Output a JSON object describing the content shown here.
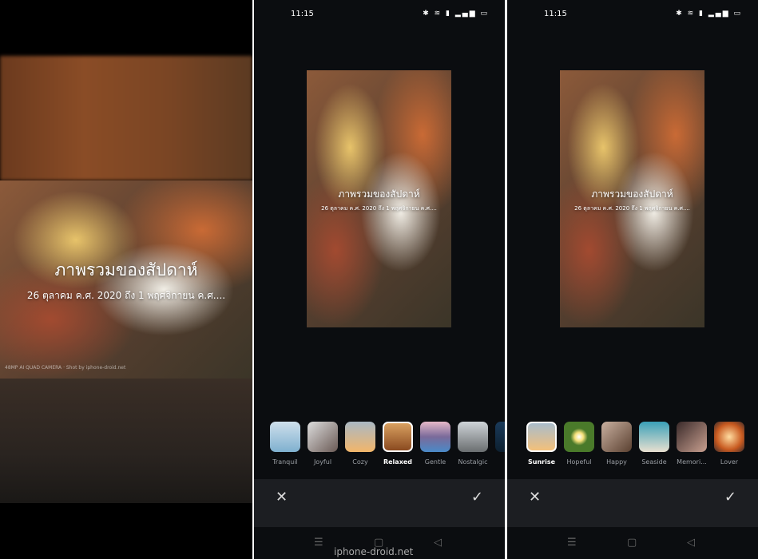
{
  "title": "ภาพรวมของสัปดาห์",
  "subtitle": "26 ตุลาคม ค.ศ. 2020 ถึง 1 พฤศจิกายน ค.ศ....",
  "camera_watermark": "48MP AI QUAD CAMERA · Shot by iphone-droid.net",
  "status": {
    "time": "11:15",
    "icons": "✱ ≋ ▮ ▂▄▆ ▭"
  },
  "panel2": {
    "filters": [
      {
        "label": "Tranquil",
        "selected": false
      },
      {
        "label": "Joyful",
        "selected": false
      },
      {
        "label": "Cozy",
        "selected": false
      },
      {
        "label": "Relaxed",
        "selected": true
      },
      {
        "label": "Gentle",
        "selected": false
      },
      {
        "label": "Nostalgic",
        "selected": false
      },
      {
        "label": "F",
        "selected": false
      }
    ]
  },
  "panel3": {
    "filters": [
      {
        "label": "Sunrise",
        "selected": true
      },
      {
        "label": "Hopeful",
        "selected": false
      },
      {
        "label": "Happy",
        "selected": false
      },
      {
        "label": "Seaside",
        "selected": false
      },
      {
        "label": "Memori...",
        "selected": false
      },
      {
        "label": "Lover",
        "selected": false
      }
    ]
  },
  "actions": {
    "cancel": "✕",
    "confirm": "✓"
  },
  "nav": {
    "menu": "☰",
    "home": "▢",
    "back": "◁"
  },
  "site_watermark": "iphone-droid.net"
}
